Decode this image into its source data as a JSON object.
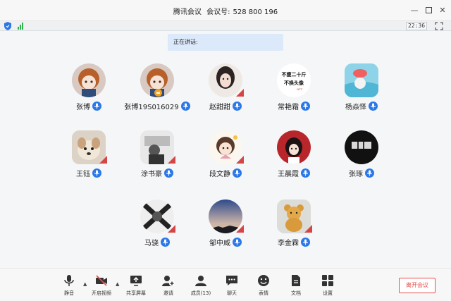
{
  "window": {
    "app_name": "腾讯会议",
    "meeting_id_label": "会议号:",
    "meeting_id": "528 800 196"
  },
  "status": {
    "time": "22:36"
  },
  "speaking": {
    "label": "正在讲话:"
  },
  "participants": [
    {
      "name": "张博"
    },
    {
      "name": "张博19S016029"
    },
    {
      "name": "赵甜甜"
    },
    {
      "name": "常艳霜"
    },
    {
      "name": "杨焱怿"
    },
    {
      "name": "王钰"
    },
    {
      "name": "涂书豪"
    },
    {
      "name": "段文静"
    },
    {
      "name": "王晨霞"
    },
    {
      "name": "张琢"
    },
    {
      "name": "马骁"
    },
    {
      "name": "邹中威"
    },
    {
      "name": "李金霖"
    }
  ],
  "avatar_text": {
    "line1": "不瘦二十斤",
    "line2": "不换头像",
    "line3": "HIT"
  },
  "toolbar": {
    "mute": "静音",
    "video": "开启视频",
    "share": "共享屏幕",
    "invite": "邀请",
    "members": "成员(13)",
    "chat": "聊天",
    "emoji": "表情",
    "docs": "文档",
    "settings": "设置",
    "leave": "离开会议"
  },
  "colors": {
    "accent": "#2a77e8",
    "leave": "#e64e4e",
    "speaking_bg": "#dce9fb",
    "signal": "#2bb24c"
  }
}
